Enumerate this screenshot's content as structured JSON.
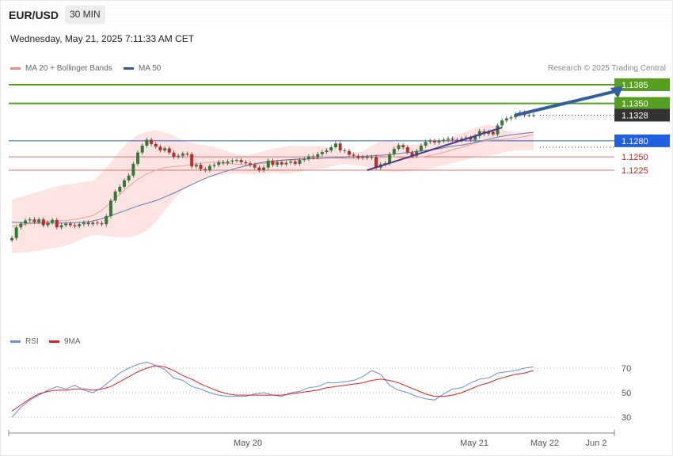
{
  "header": {
    "pair": "EUR/USD",
    "timeframe": "30 MIN",
    "datetime": "Wednesday, May 21, 2025 7:11:33 AM CET",
    "credit": "Research © 2025 Trading Central"
  },
  "legend": {
    "ma20": {
      "label": "MA 20 + Bollinger Bands",
      "color": "#f08a80"
    },
    "ma50": {
      "label": "MA 50",
      "color": "#2c5c9c"
    }
  },
  "rsi_legend": {
    "rsi": {
      "label": "RSI",
      "color": "#6a8ee0"
    },
    "ma9": {
      "label": "9MA",
      "color": "#e02020"
    }
  },
  "colors": {
    "up": "#2e7d32",
    "down": "#c62828",
    "target": "#55a020",
    "pivot": "#2060e0",
    "support": "#e07070",
    "current": "#333333",
    "arrow": "#2f5f9f"
  },
  "chart_data": [
    {
      "type": "candlestick",
      "title": "",
      "x_ticks": [
        "May 20",
        "May 21",
        "May 22",
        "Jun 2"
      ],
      "ylim": [
        1.1085,
        1.1395
      ],
      "levels": [
        {
          "label": "1.1385",
          "value": 1.1385,
          "role": "target"
        },
        {
          "label": "1.1350",
          "value": 1.135,
          "role": "target"
        },
        {
          "label": "1.1328",
          "value": 1.1328,
          "role": "current"
        },
        {
          "label": "1.1280",
          "value": 1.128,
          "role": "pivot"
        },
        {
          "label": "1.1250",
          "value": 1.125,
          "role": "support"
        },
        {
          "label": "1.1225",
          "value": 1.1225,
          "role": "support"
        }
      ],
      "close": [
        1.1098,
        1.1118,
        1.1125,
        1.1131,
        1.1133,
        1.1128,
        1.1133,
        1.1122,
        1.1127,
        1.1132,
        1.1118,
        1.1122,
        1.1125,
        1.1122,
        1.112,
        1.1124,
        1.1127,
        1.1124,
        1.1127,
        1.1126,
        1.1124,
        1.1139,
        1.1168,
        1.1185,
        1.1194,
        1.1206,
        1.1215,
        1.1237,
        1.1258,
        1.1271,
        1.1282,
        1.1274,
        1.1269,
        1.1262,
        1.1266,
        1.1258,
        1.125,
        1.1252,
        1.1256,
        1.1255,
        1.1232,
        1.1235,
        1.1227,
        1.1225,
        1.1233,
        1.1235,
        1.124,
        1.1238,
        1.1241,
        1.1243,
        1.1244,
        1.124,
        1.1238,
        1.1235,
        1.123,
        1.1225,
        1.123,
        1.1243,
        1.1235,
        1.124,
        1.1236,
        1.1239,
        1.1241,
        1.1237,
        1.1244,
        1.1246,
        1.1251,
        1.1249,
        1.1255,
        1.1259,
        1.1262,
        1.1268,
        1.1275,
        1.1262,
        1.1261,
        1.1254,
        1.1252,
        1.1248,
        1.125,
        1.1248,
        1.125,
        1.123,
        1.1236,
        1.1238,
        1.1255,
        1.1265,
        1.1272,
        1.1268,
        1.1258,
        1.1252,
        1.1261,
        1.1271,
        1.1278,
        1.128,
        1.1277,
        1.128,
        1.1282,
        1.1284,
        1.1282,
        1.1281,
        1.1284,
        1.1286,
        1.1282,
        1.1289,
        1.1298,
        1.1293,
        1.1297,
        1.1292,
        1.1309,
        1.1318,
        1.1322,
        1.1324,
        1.133,
        1.1333,
        1.1328,
        1.1328,
        1.1328
      ],
      "series": [
        {
          "name": "MA 20 + Bollinger Bands",
          "upper": [
            1.117,
            1.1175,
            1.118,
            1.1185,
            1.119,
            1.1195,
            1.1198,
            1.12,
            1.1203,
            1.1205,
            1.122,
            1.124,
            1.1262,
            1.1279,
            1.1291,
            1.1297,
            1.13,
            1.1296,
            1.129,
            1.1281,
            1.1276,
            1.1273,
            1.127,
            1.1266,
            1.126,
            1.1255,
            1.1253,
            1.1256,
            1.1261,
            1.1265,
            1.1268,
            1.1271,
            1.127,
            1.1269,
            1.1271,
            1.1268,
            1.1263,
            1.1259,
            1.1258,
            1.126,
            1.1271,
            1.1278,
            1.128,
            1.1276,
            1.1272,
            1.1273,
            1.1275,
            1.1278,
            1.1282,
            1.1288,
            1.1294,
            1.1301,
            1.1307,
            1.1311,
            1.1307,
            1.1299,
            1.1297,
            1.1297,
            1.1297
          ],
          "lower": [
            1.107,
            1.1071,
            1.1072,
            1.1075,
            1.1078,
            1.108,
            1.1084,
            1.109,
            1.1098,
            1.1104,
            1.1103,
            1.1101,
            1.1099,
            1.11,
            1.1104,
            1.1112,
            1.1128,
            1.115,
            1.117,
            1.1188,
            1.1198,
            1.1206,
            1.1211,
            1.1215,
            1.1218,
            1.1219,
            1.1218,
            1.1218,
            1.1219,
            1.122,
            1.1219,
            1.1219,
            1.1222,
            1.1226,
            1.1227,
            1.123,
            1.1234,
            1.1237,
            1.1235,
            1.1233,
            1.1228,
            1.1224,
            1.1222,
            1.1222,
            1.1223,
            1.1225,
            1.1227,
            1.123,
            1.1234,
            1.1238,
            1.1242,
            1.1247,
            1.1251,
            1.1252,
            1.1255,
            1.126,
            1.1262,
            1.1262,
            1.1262
          ]
        }
      ],
      "ma20": [
        1.112,
        1.1123,
        1.1125,
        1.1127,
        1.1129,
        1.113,
        1.1131,
        1.1133,
        1.1136,
        1.114,
        1.115,
        1.1165,
        1.118,
        1.1195,
        1.1208,
        1.1218,
        1.1225,
        1.123,
        1.1232,
        1.1233,
        1.1236,
        1.1238,
        1.124,
        1.124,
        1.1238,
        1.1236,
        1.1235,
        1.1236,
        1.1238,
        1.124,
        1.1243,
        1.1244,
        1.1245,
        1.1247,
        1.1249,
        1.125,
        1.1249,
        1.1247,
        1.1247,
        1.1248,
        1.125,
        1.1251,
        1.1251,
        1.1249,
        1.1247,
        1.1249,
        1.1251,
        1.1254,
        1.1258,
        1.1263,
        1.1268,
        1.1273,
        1.1278,
        1.1281,
        1.1282,
        1.1283,
        1.1285,
        1.1288,
        1.1292
      ],
      "ma50": [
        1.1128,
        1.1127,
        1.1126,
        1.1126,
        1.1126,
        1.1126,
        1.1126,
        1.1127,
        1.1128,
        1.113,
        1.1134,
        1.114,
        1.1146,
        1.1152,
        1.1158,
        1.1163,
        1.1168,
        1.1175,
        1.1182,
        1.119,
        1.1198,
        1.1206,
        1.1213,
        1.1219,
        1.1224,
        1.1229,
        1.1233,
        1.1237,
        1.124,
        1.1242,
        1.1244,
        1.1245,
        1.1246,
        1.1246,
        1.1247,
        1.1248,
        1.1248,
        1.1249,
        1.125,
        1.1251,
        1.1252,
        1.1253,
        1.1254,
        1.1256,
        1.1258,
        1.126,
        1.1262,
        1.1264,
        1.1267,
        1.127,
        1.1272,
        1.1275,
        1.1279,
        1.1283,
        1.1287,
        1.129,
        1.1292,
        1.1294,
        1.1296
      ],
      "trendline": {
        "from": [
          79,
          1.1225
        ],
        "to": [
          109,
          1.1305
        ]
      },
      "arrow": {
        "from": [
          112,
          1.1328
        ],
        "to": [
          126,
          1.1385
        ]
      }
    },
    {
      "type": "line",
      "title": "",
      "ylim": [
        25,
        77
      ],
      "y_ticks": [
        30,
        50,
        70
      ],
      "series": [
        {
          "name": "RSI",
          "values": [
            30,
            38,
            44,
            48,
            52,
            55,
            53,
            56,
            52,
            50,
            54,
            60,
            66,
            70,
            73,
            75,
            72,
            69,
            62,
            60,
            55,
            53,
            50,
            48,
            47,
            47,
            47,
            49,
            50,
            48,
            47,
            50,
            51,
            54,
            55,
            58,
            58,
            59,
            60,
            63,
            68,
            65,
            56,
            52,
            50,
            47,
            45,
            44,
            49,
            53,
            54,
            58,
            61,
            62,
            66,
            67,
            68,
            70,
            71
          ]
        },
        {
          "name": "9MA",
          "values": [
            35,
            40,
            45,
            49,
            51,
            52,
            52,
            53,
            53,
            52,
            53,
            55,
            59,
            63,
            67,
            70,
            72,
            71,
            68,
            64,
            61,
            57,
            54,
            51,
            49,
            48,
            48,
            48,
            48,
            48,
            48,
            49,
            50,
            51,
            52,
            54,
            55,
            56,
            57,
            58,
            60,
            61,
            60,
            58,
            55,
            52,
            49,
            47,
            47,
            48,
            50,
            53,
            56,
            58,
            61,
            63,
            65,
            66,
            68
          ]
        }
      ],
      "legend_position": "top-left"
    }
  ]
}
